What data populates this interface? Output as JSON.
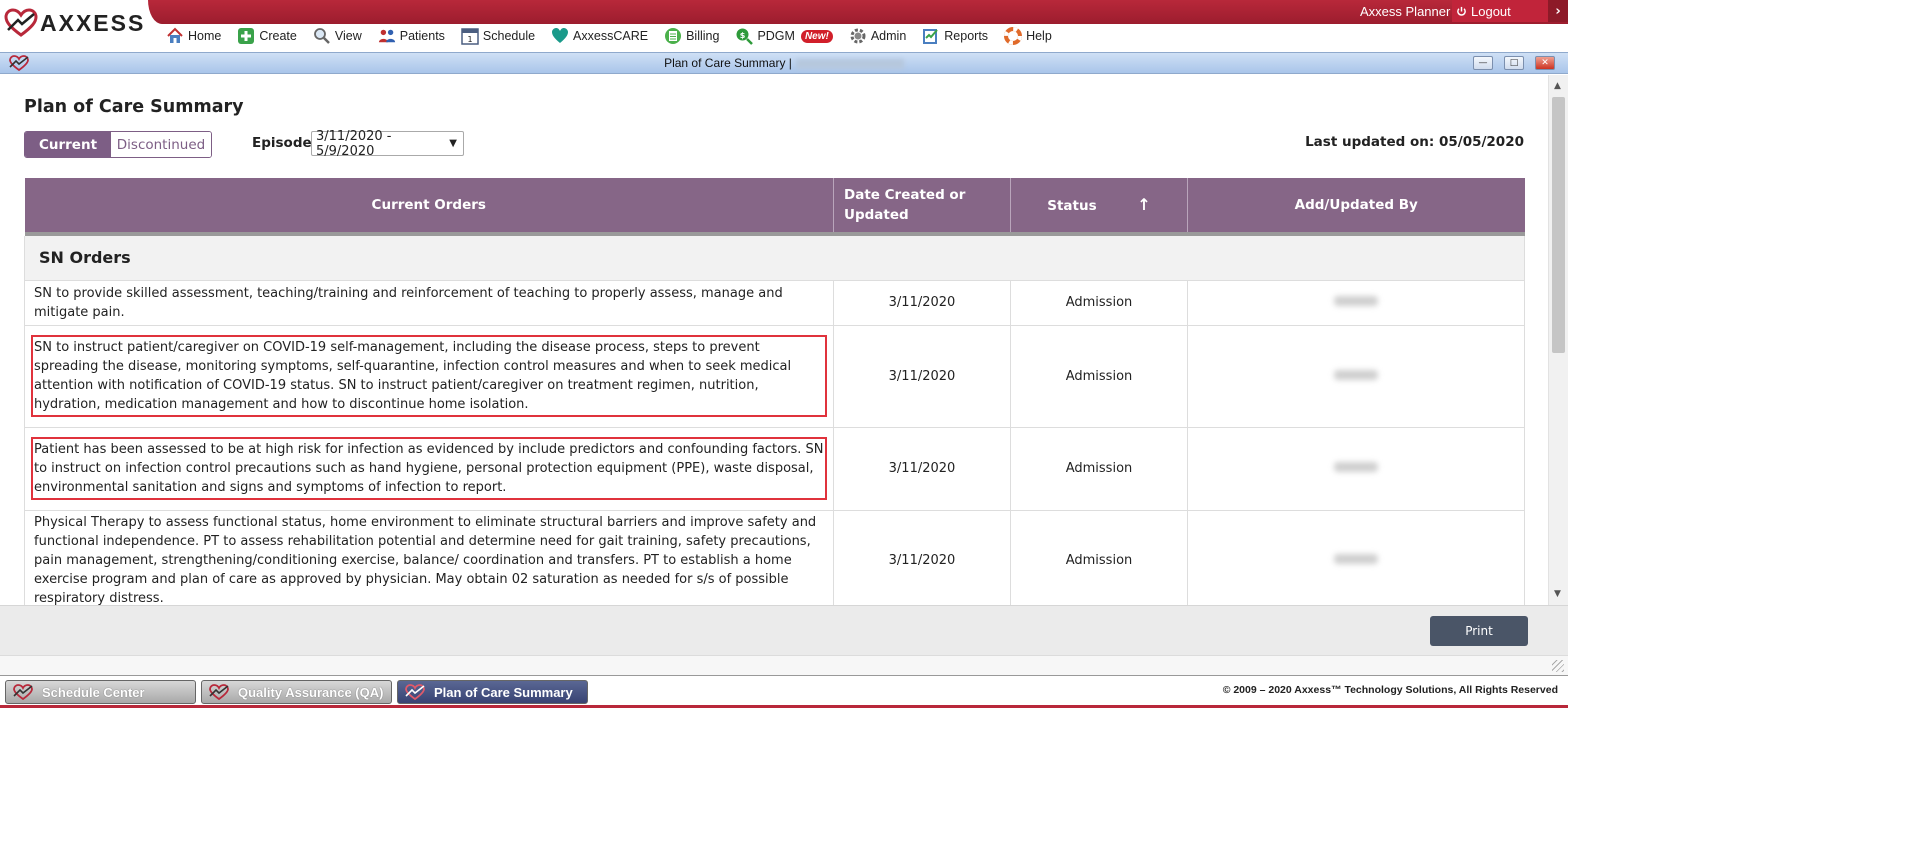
{
  "header": {
    "logo_text": "AXXESS",
    "planner_label": "Axxess Planner",
    "logout_label": "Logout",
    "nav": [
      {
        "label": "Home",
        "icon": "home-icon"
      },
      {
        "label": "Create",
        "icon": "plus-icon"
      },
      {
        "label": "View",
        "icon": "magnifier-icon"
      },
      {
        "label": "Patients",
        "icon": "people-icon"
      },
      {
        "label": "Schedule",
        "icon": "calendar-icon"
      },
      {
        "label": "AxxessCARE",
        "icon": "heart-icon"
      },
      {
        "label": "Billing",
        "icon": "calculator-icon"
      },
      {
        "label": "PDGM",
        "icon": "money-search-icon",
        "badge": "New!"
      },
      {
        "label": "Admin",
        "icon": "gear-icon"
      },
      {
        "label": "Reports",
        "icon": "report-icon"
      },
      {
        "label": "Help",
        "icon": "lifebuoy-icon"
      }
    ]
  },
  "window": {
    "title": "Plan of Care Summary |"
  },
  "page": {
    "title": "Plan of Care Summary",
    "toggle": {
      "current": "Current",
      "discontinued": "Discontinued"
    },
    "episode_label": "Episode:",
    "episode_value": "3/11/2020 - 5/9/2020",
    "last_updated": "Last updated on: 05/05/2020"
  },
  "table": {
    "headers": {
      "orders": "Current Orders",
      "date": "Date Created or Updated",
      "status": "Status",
      "status_sort": "↑",
      "added_by": "Add/Updated By"
    },
    "group": "SN Orders",
    "rows": [
      {
        "order": "SN to provide skilled assessment, teaching/training and reinforcement of teaching to properly assess, manage and mitigate pain.",
        "date": "3/11/2020",
        "status": "Admission",
        "highlighted": false
      },
      {
        "order": "SN to instruct patient/caregiver on COVID-19 self-management, including the disease process, steps to prevent spreading the disease, monitoring symptoms, self-quarantine, infection control measures and when to seek medical attention with notification of COVID-19 status. SN to instruct patient/caregiver on treatment regimen, nutrition, hydration, medication management and how to discontinue home isolation.",
        "date": "3/11/2020",
        "status": "Admission",
        "highlighted": true
      },
      {
        "order": "Patient has been assessed to be at high risk for infection as evidenced by include predictors and confounding factors. SN to instruct on infection control precautions such as hand hygiene, personal protection equipment (PPE), waste disposal, environmental sanitation and signs and symptoms of infection to report.",
        "date": "3/11/2020",
        "status": "Admission",
        "highlighted": true
      },
      {
        "order": "Physical Therapy to assess functional status, home environment to eliminate structural barriers and improve safety and functional independence. PT to assess rehabilitation potential and determine need for gait training, safety precautions, pain management, strengthening/conditioning exercise, balance/ coordination and transfers. PT to establish a home exercise program and plan of care as approved by physician. May obtain 02 saturation as needed for s/s of possible respiratory distress.",
        "date": "3/11/2020",
        "status": "Admission",
        "highlighted": false
      }
    ]
  },
  "footer": {
    "print_label": "Print",
    "copyright": "© 2009 – 2020 Axxess™ Technology Solutions, All Rights Reserved"
  },
  "taskbar": {
    "tabs": [
      {
        "label": "Schedule Center",
        "active": false
      },
      {
        "label": "Quality Assurance (QA)",
        "active": false
      },
      {
        "label": "Plan of Care Summary",
        "active": true
      }
    ]
  },
  "colors": {
    "brand_red": "#b8283a",
    "table_header": "#866687",
    "toggle_active": "#7d5e85",
    "highlight_box": "#e0323c",
    "print_button": "#4a5567"
  }
}
